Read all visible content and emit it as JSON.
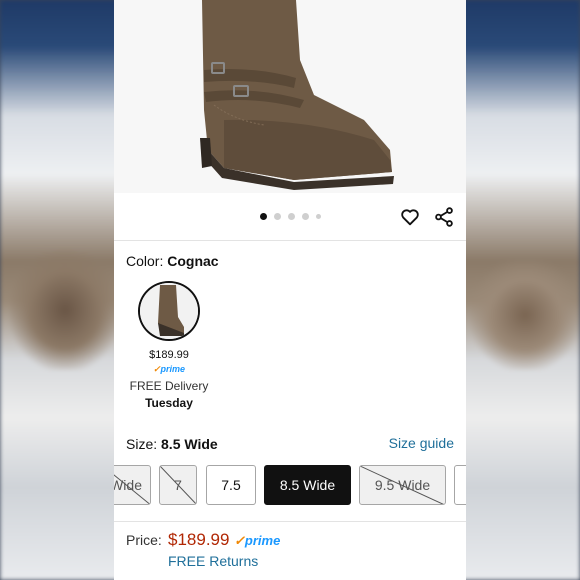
{
  "product": {
    "color_label": "Color:",
    "color_value": "Cognac",
    "image_dots": 5,
    "active_dot": 0
  },
  "swatch": {
    "price": "$189.99",
    "prime": "prime",
    "delivery": "FREE Delivery",
    "day": "Tuesday"
  },
  "size": {
    "label": "Size:",
    "value": "8.5 Wide",
    "guide_link": "Size guide",
    "options": [
      {
        "label": "Wide",
        "state": "unavailable"
      },
      {
        "label": "7",
        "state": "unavailable"
      },
      {
        "label": "7.5",
        "state": "available"
      },
      {
        "label": "8.5 Wide",
        "state": "selected"
      },
      {
        "label": "9.5 Wide",
        "state": "unavailable"
      },
      {
        "label": "",
        "state": "available"
      }
    ]
  },
  "price": {
    "label": "Price:",
    "value": "$189.99",
    "prime": "prime",
    "returns": "FREE Returns"
  },
  "icons": [
    "heart-icon",
    "share-icon",
    "checkmark-icon"
  ],
  "colors": {
    "price_red": "#b12704",
    "link_blue": "#1f6f9a",
    "prime_blue": "#1a98ff",
    "prime_orange": "#f08804",
    "selected_bg": "#111111",
    "boot_brown": "#6e5a45"
  }
}
